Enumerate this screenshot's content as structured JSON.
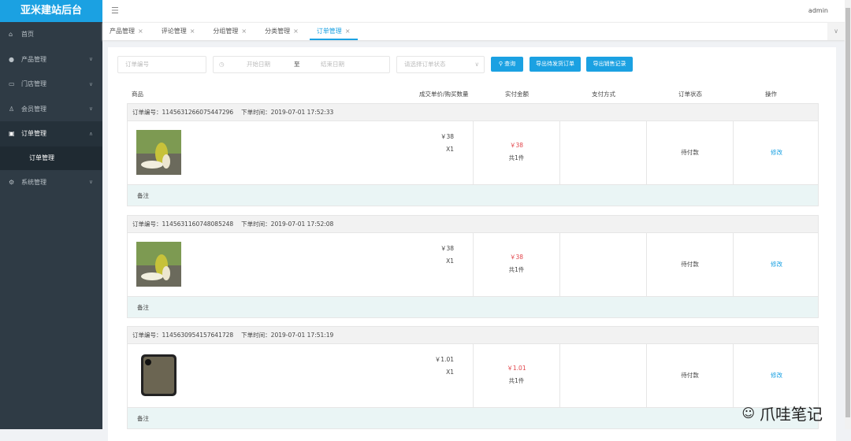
{
  "app": {
    "title": "亚米建站后台",
    "user": "admin"
  },
  "sidebar": {
    "items": [
      {
        "label": "首页",
        "icon": "home-icon"
      },
      {
        "label": "产品管理",
        "icon": "user-icon"
      },
      {
        "label": "门店管理",
        "icon": "store-icon"
      },
      {
        "label": "会员管理",
        "icon": "member-icon"
      },
      {
        "label": "订单管理",
        "icon": "order-icon",
        "sub": "订单管理"
      },
      {
        "label": "系统管理",
        "icon": "gear-icon"
      }
    ]
  },
  "tabs": [
    {
      "label": "产品管理"
    },
    {
      "label": "评论管理"
    },
    {
      "label": "分组管理"
    },
    {
      "label": "分类管理"
    },
    {
      "label": "订单管理",
      "active": true
    }
  ],
  "filters": {
    "order_no_placeholder": "订单编号",
    "start_placeholder": "开始日期",
    "sep": "至",
    "end_placeholder": "结束日期",
    "status_placeholder": "请选择订单状态",
    "search": "查询",
    "export_pending": "导出待发货订单",
    "export_sales": "导出销售记录"
  },
  "columns": [
    "商品",
    "成交单价/购买数量",
    "实付金额",
    "支付方式",
    "订单状态",
    "操作"
  ],
  "orders": [
    {
      "no_label": "订单编号：",
      "no": "1145631266075447296",
      "time_label": "下单时间：",
      "time": "2019-07-01 17:52:33",
      "image": "pear",
      "price": "￥38",
      "qty": "X1",
      "paid": "￥38",
      "count": "共1件",
      "payment": "",
      "status": "待付款",
      "action": "修改",
      "remark": "备注"
    },
    {
      "no_label": "订单编号：",
      "no": "1145631160748085248",
      "time_label": "下单时间：",
      "time": "2019-07-01 17:52:08",
      "image": "pear",
      "price": "￥38",
      "qty": "X1",
      "paid": "￥38",
      "count": "共1件",
      "payment": "",
      "status": "待付款",
      "action": "修改",
      "remark": "备注"
    },
    {
      "no_label": "订单编号：",
      "no": "1145630954157641728",
      "time_label": "下单时间：",
      "time": "2019-07-01 17:51:19",
      "image": "phone",
      "price": "￥1.01",
      "qty": "X1",
      "paid": "￥1.01",
      "count": "共1件",
      "payment": "",
      "status": "待付款",
      "action": "修改",
      "remark": "备注"
    }
  ],
  "watermark": "爪哇笔记",
  "colors": {
    "accent": "#1ba1e2",
    "sidebar": "#2f3b45",
    "price": "#e2454b"
  }
}
